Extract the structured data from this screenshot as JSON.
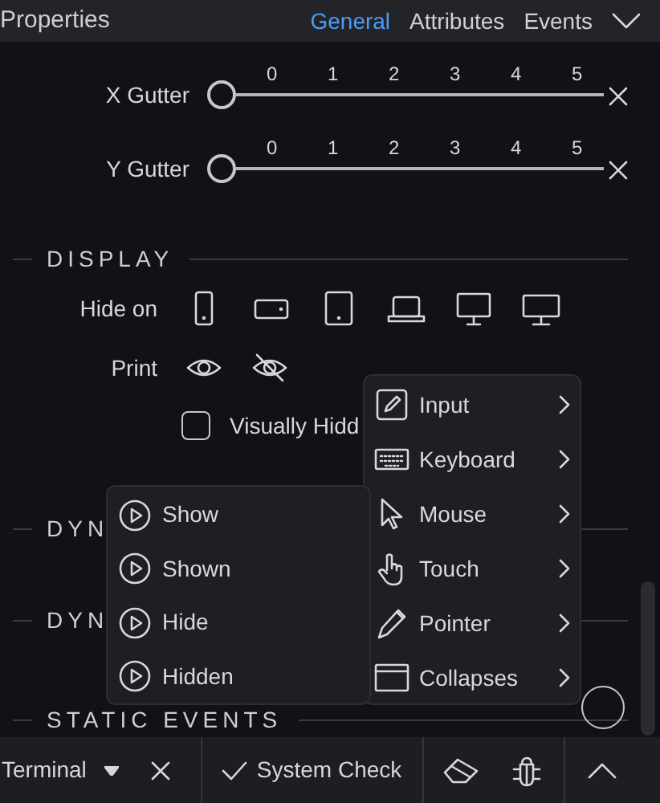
{
  "header": {
    "title": "Properties",
    "tabs": [
      {
        "label": "General",
        "selected": true
      },
      {
        "label": "Attributes",
        "selected": false
      },
      {
        "label": "Events",
        "selected": false
      }
    ]
  },
  "gutters": [
    {
      "label": "X Gutter",
      "ticks": [
        "0",
        "1",
        "2",
        "3",
        "4",
        "5"
      ],
      "level": 0
    },
    {
      "label": "Y Gutter",
      "ticks": [
        "0",
        "1",
        "2",
        "3",
        "4",
        "5"
      ],
      "level": 0
    }
  ],
  "display": {
    "heading": "DISPLAY",
    "hide_on": {
      "label": "Hide on",
      "devices": [
        {
          "kind": "phone"
        },
        {
          "kind": "phone-landscape"
        },
        {
          "kind": "tablet"
        },
        {
          "kind": "laptop"
        },
        {
          "kind": "desktop"
        },
        {
          "kind": "wide-desktop"
        }
      ]
    },
    "print": {
      "label": "Print",
      "options": [
        {
          "kind": "visible"
        },
        {
          "kind": "hidden"
        }
      ]
    },
    "visually_hidden": {
      "label": "Visually Hidd",
      "checked": false
    }
  },
  "sections": [
    {
      "heading": "DYN"
    },
    {
      "heading": "DYN"
    },
    {
      "heading": "STATIC EVENTS"
    }
  ],
  "event_menu": [
    {
      "kind": "input",
      "label": "Input"
    },
    {
      "kind": "keyboard",
      "label": "Keyboard"
    },
    {
      "kind": "mouse",
      "label": "Mouse"
    },
    {
      "kind": "touch",
      "label": "Touch"
    },
    {
      "kind": "pointer",
      "label": "Pointer"
    },
    {
      "kind": "collapses",
      "label": "Collapses"
    }
  ],
  "submenu": [
    {
      "label": "Show"
    },
    {
      "label": "Shown"
    },
    {
      "label": "Hide"
    },
    {
      "label": "Hidden"
    }
  ],
  "bottom_bar": {
    "terminal": "Terminal",
    "system_check": "System Check"
  }
}
